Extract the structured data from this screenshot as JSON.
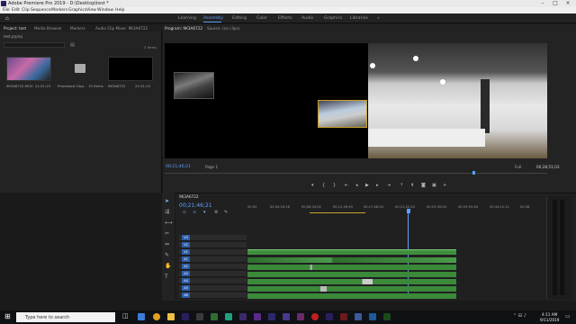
{
  "window": {
    "title": "Adobe Premiere Pro 2019 - D:\\Desktop\\test *"
  },
  "menu": [
    "File",
    "Edit",
    "Clip",
    "Sequence",
    "Markers",
    "Graphics",
    "View",
    "Window",
    "Help"
  ],
  "workspaces": {
    "items": [
      "Learning",
      "Assembly",
      "Editing",
      "Color",
      "Effects",
      "Audio",
      "Graphics",
      "Libraries"
    ],
    "active": "Assembly"
  },
  "project": {
    "tabs": [
      "Project: test",
      "Media Browser",
      "Markers",
      "Audio Clip Mixer: 9K3A6722"
    ],
    "name": "test.prproj",
    "item_count": "3 Items",
    "items": [
      {
        "name": "9K3A6722.MOV",
        "duration": "21:51:23"
      },
      {
        "name": "Processed Clips",
        "count": "15 Items"
      },
      {
        "name": "9K3A6722",
        "duration": "21:51:23"
      }
    ]
  },
  "program": {
    "tabs": [
      "Program: 9K3A6722",
      "Source: (no clips)"
    ],
    "timecode": "00;21;46;21",
    "fit": "Page 1",
    "zoom": "Full",
    "duration": "00;28;51;03"
  },
  "timeline": {
    "tab": "9K3A6722",
    "timecode": "00;21;46;21",
    "ruler": [
      "00;00",
      "00;04;16;16",
      "00;08;33;02",
      "00;12;49;49",
      "00;17;06;04",
      "00;21;22;20",
      "00;25;39;04",
      "00;29;55;46",
      "00;34;12;12",
      "00;38"
    ],
    "tracks": [
      "V3",
      "V2",
      "V1",
      "A1",
      "A2",
      "A3",
      "A4",
      "A5",
      "A6"
    ]
  },
  "taskbar": {
    "search_placeholder": "Type here to search",
    "time": "4:11 AM",
    "date": "9/11/2019"
  },
  "colors": {
    "accent": "#5aa0ff",
    "clip_green": "#3e8e3e",
    "video_label": "#2d5ea8"
  }
}
